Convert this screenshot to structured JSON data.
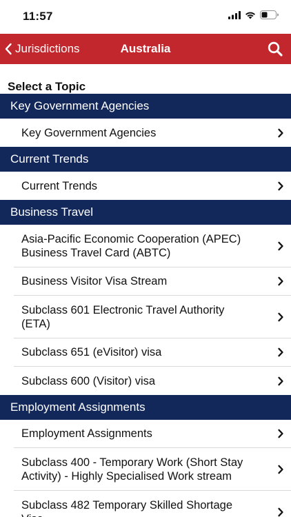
{
  "status": {
    "time": "11:57"
  },
  "nav": {
    "back_label": "Jurisdictions",
    "title": "Australia"
  },
  "heading": "Select a Topic",
  "sections": [
    {
      "title": "Key Government Agencies",
      "items": [
        {
          "lines": [
            "Key Government Agencies"
          ]
        }
      ]
    },
    {
      "title": "Current Trends",
      "items": [
        {
          "lines": [
            "Current Trends"
          ]
        }
      ]
    },
    {
      "title": "Business Travel",
      "items": [
        {
          "lines": [
            "Asia-Pacific Economic Cooperation (APEC)",
            "Business Travel Card (ABTC)"
          ]
        },
        {
          "lines": [
            "Business Visitor Visa Stream"
          ]
        },
        {
          "lines": [
            "Subclass 601 Electronic Travel Authority",
            "(ETA)"
          ]
        },
        {
          "lines": [
            "Subclass 651 (eVisitor) visa"
          ]
        },
        {
          "lines": [
            "Subclass 600 (Visitor) visa"
          ]
        }
      ]
    },
    {
      "title": "Employment Assignments",
      "items": [
        {
          "lines": [
            "Employment Assignments"
          ]
        },
        {
          "lines": [
            "Subclass 400 - Temporary Work (Short Stay",
            "Activity) - Highly Specialised Work stream"
          ]
        },
        {
          "lines": [
            "Subclass 482 Temporary Skilled Shortage",
            "Visa"
          ]
        }
      ]
    }
  ],
  "colors": {
    "nav_red": "#c1272d",
    "section_navy": "#13285a"
  },
  "icons": [
    "signal-icon",
    "wifi-icon",
    "battery-icon",
    "back-chevron-icon",
    "search-icon",
    "chevron-right-icon"
  ]
}
